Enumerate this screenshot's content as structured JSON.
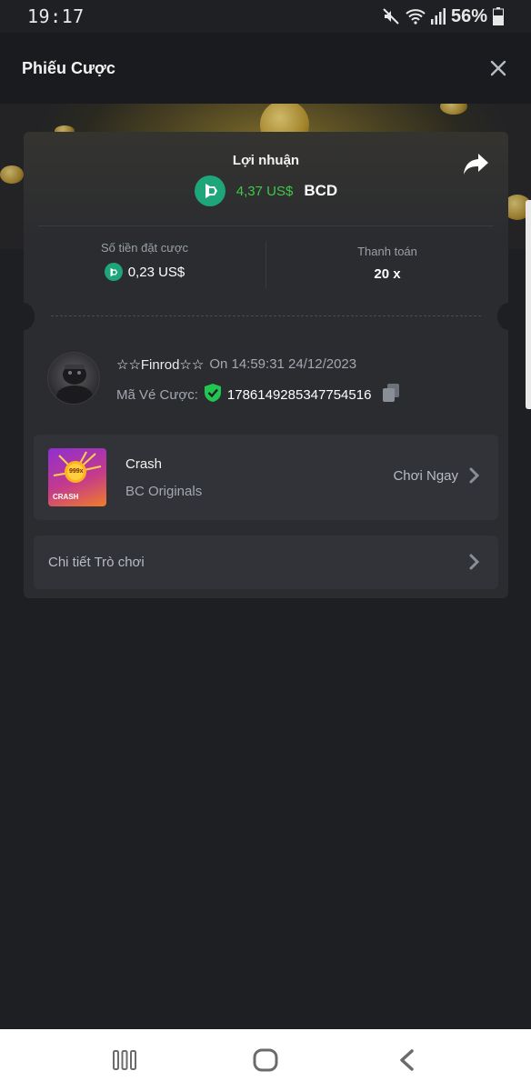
{
  "status_bar": {
    "time": "19:17",
    "battery": "56%"
  },
  "header": {
    "title": "Phiếu Cược"
  },
  "ticket": {
    "profit_label": "Lợi nhuận",
    "profit_value": "4,37 US$",
    "profit_currency": "BCD",
    "bet_amount_label": "Số tiền đặt cược",
    "bet_amount_value": "0,23 US$",
    "payout_label": "Thanh toán",
    "payout_value": "20 x"
  },
  "user": {
    "name": "☆☆Finrod☆☆",
    "time": "On 14:59:31 24/12/2023",
    "ticket_label": "Mã Vé Cược:",
    "ticket_id": "1786149285347754516"
  },
  "game": {
    "name": "Crash",
    "provider": "BC Originals",
    "play_label": "Chơi Ngay",
    "thumb_text": "CRASH",
    "thumb_multiplier": "999x"
  },
  "details": {
    "label": "Chi tiết Trò chơi"
  },
  "colors": {
    "profit_green": "#3ec84a",
    "coin_teal": "#1ea67a",
    "card_bg": "#2b2c30",
    "page_bg": "#1e1f22"
  }
}
